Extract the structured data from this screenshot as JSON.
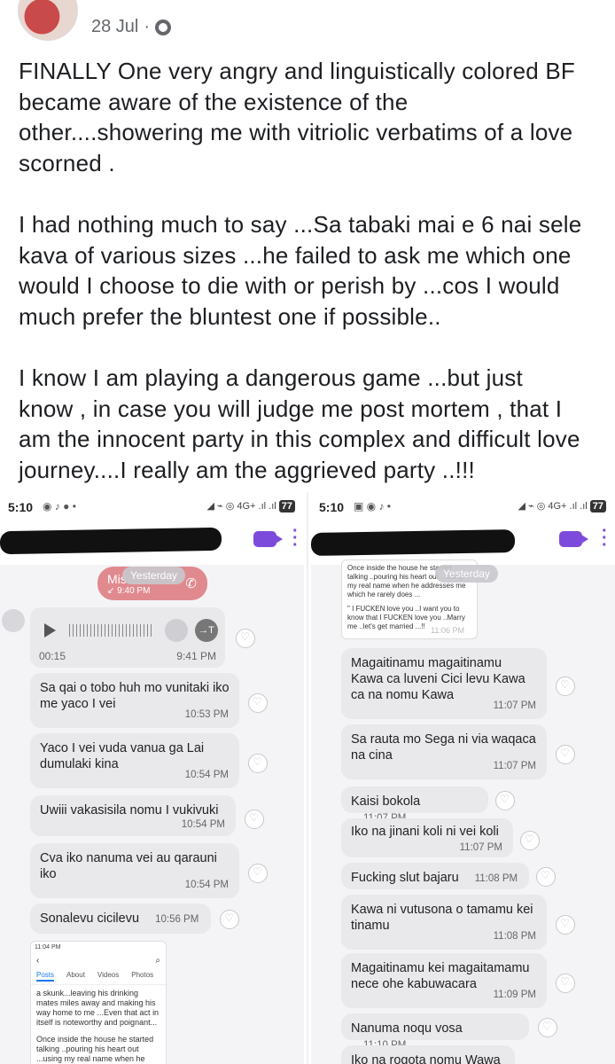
{
  "post": {
    "date": "28 Jul",
    "separator": "·",
    "paragraphs": [
      "FINALLY One very angry and linguistically colored BF\nbecame aware of the existence of the\nother....showering me with vitriolic verbatims  of a love\nscorned .",
      "I had nothing much to say ...Sa tabaki mai e 6 nai sele\nkava of various sizes ...he failed to ask me which one\nwould I choose to die with or perish by  ...cos I would\nmuch prefer the bluntest one if possible..",
      "I know I am playing a dangerous game ...but just\nknow , in case you will judge me post mortem , that I\nam the innocent party in this complex and difficult love\njourney....I really am the aggrieved party ..!!!"
    ]
  },
  "left_phone": {
    "status": {
      "time": "5:10",
      "network": "4G+",
      "battery": "77"
    },
    "date_divider": "Yesterday",
    "missed_call": {
      "label": "Mis",
      "time": "9:40 PM"
    },
    "voice": {
      "duration": "00:15",
      "time": "9:41 PM"
    },
    "messages": [
      {
        "text": "Sa qai o tobo huh mo vunitaki iko me yaco I vei",
        "time": "10:53 PM"
      },
      {
        "text": "Yaco I vei vuda vanua ga Lai dumulaki kina",
        "time": "10:54 PM"
      },
      {
        "text": "Uwiii vakasisila nomu I vukivuki",
        "time": "10:54 PM"
      },
      {
        "text": "Cva iko nanuma vei au qarauni iko",
        "time": "10:54 PM"
      },
      {
        "text": "Sonalevu cicilevu",
        "time": "10:56 PM"
      }
    ],
    "screenshot": {
      "status": "11:04 PM",
      "tabs": [
        "Posts",
        "About",
        "Videos",
        "Photos"
      ],
      "text1": "a skunk...leaving his drinking mates miles away and making his way home to me ...Even that act in itself is noteworthy and poignant...",
      "text2": "Once inside the house he started talking ..pouring his heart out ...using my real name when he addresses me which he rarely does..."
    }
  },
  "right_phone": {
    "status": {
      "time": "5:10",
      "network": "4G+",
      "battery": "77"
    },
    "date_divider": "Yesterday",
    "shared": {
      "text1": "Once inside the house he started talking ..pouring his heart out ...using my real name when he addresses me which he rarely does ...",
      "text2": "\" I FUCKEN love you ..I want you to know that I FUCKEN love you ..Marry me ..let's get married ...!!",
      "time": "11:06 PM"
    },
    "messages": [
      {
        "text": "Magaitinamu magaitinamu Kawa ca luveni Cici levu Kawa ca na nomu Kawa",
        "time": "11:07 PM"
      },
      {
        "text": "Sa rauta mo Sega ni via waqaca na cina",
        "time": "11:07 PM"
      },
      {
        "text": "Kaisi bokola",
        "time": "11:07 PM"
      },
      {
        "text": "Iko na jinani koli ni vei koli",
        "time": "11:07 PM"
      },
      {
        "text": "Fucking slut bajaru",
        "time": "11:08 PM"
      },
      {
        "text": "Kawa ni vutusona o tamamu kei tinamu",
        "time": "11:08 PM"
      },
      {
        "text": "Magaitinamu kei magaitamamu nece ohe kabuwacara",
        "time": "11:09 PM"
      },
      {
        "text": "Nanuma noqu vosa",
        "time": "11:10 PM"
      },
      {
        "text": "Iko na rogota nomu Wawa",
        "time": ""
      }
    ]
  },
  "colors": {
    "accent": "#7d4bdb",
    "missed_call": "#e08a8f",
    "bubble": "#e9e9ec"
  }
}
